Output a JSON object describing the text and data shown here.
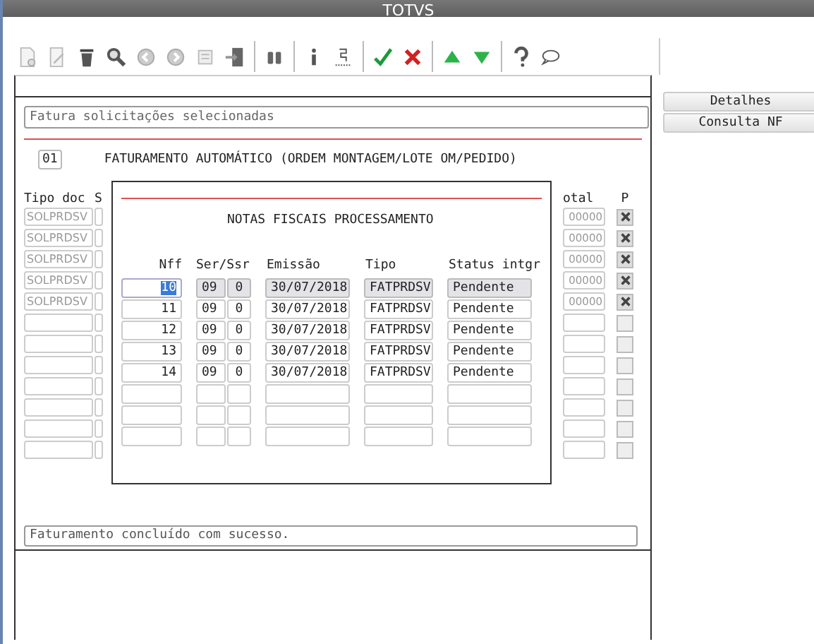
{
  "window": {
    "title": "TOTVS"
  },
  "side_buttons": [
    "Detalhes",
    "Consulta NF"
  ],
  "header_field": {
    "value": "Fatura solicitações selecionadas"
  },
  "section": {
    "code": "01",
    "title": "FATURAMENTO AUTOMÁTICO (ORDEM MONTAGEM/LOTE OM/PEDIDO)"
  },
  "table": {
    "columns": [
      "Tipo doc",
      "S",
      "otal",
      "P"
    ],
    "rows": [
      {
        "tipo": "SOLPRDSV",
        "total": "00000",
        "checked": true
      },
      {
        "tipo": "SOLPRDSV",
        "total": "00000",
        "checked": true
      },
      {
        "tipo": "SOLPRDSV",
        "total": "00000",
        "checked": true
      },
      {
        "tipo": "SOLPRDSV",
        "total": "00000",
        "checked": true
      },
      {
        "tipo": "SOLPRDSV",
        "total": "00000",
        "checked": true
      },
      {
        "checked": false
      },
      {
        "checked": false
      },
      {
        "checked": false
      },
      {
        "checked": false
      },
      {
        "checked": false
      },
      {
        "checked": false
      },
      {
        "checked": false
      }
    ]
  },
  "dialog": {
    "title": "NOTAS FISCAIS PROCESSAMENTO",
    "columns": [
      "Nff",
      "Ser/Ssr",
      "Emissão",
      "Tipo",
      "Status intgr"
    ],
    "rows": [
      {
        "nff": "10",
        "ser": "09",
        "ssr": "0",
        "emissao": "30/07/2018",
        "tipo": "FATPRDSV",
        "status": "Pendente",
        "selected": true
      },
      {
        "nff": "11",
        "ser": "09",
        "ssr": "0",
        "emissao": "30/07/2018",
        "tipo": "FATPRDSV",
        "status": "Pendente",
        "selected": false
      },
      {
        "nff": "12",
        "ser": "09",
        "ssr": "0",
        "emissao": "30/07/2018",
        "tipo": "FATPRDSV",
        "status": "Pendente",
        "selected": false
      },
      {
        "nff": "13",
        "ser": "09",
        "ssr": "0",
        "emissao": "30/07/2018",
        "tipo": "FATPRDSV",
        "status": "Pendente",
        "selected": false
      },
      {
        "nff": "14",
        "ser": "09",
        "ssr": "0",
        "emissao": "30/07/2018",
        "tipo": "FATPRDSV",
        "status": "Pendente",
        "selected": false
      },
      {
        "selected": false
      },
      {
        "selected": false
      },
      {
        "selected": false
      }
    ]
  },
  "status_bar": "Faturamento concluído com sucesso."
}
